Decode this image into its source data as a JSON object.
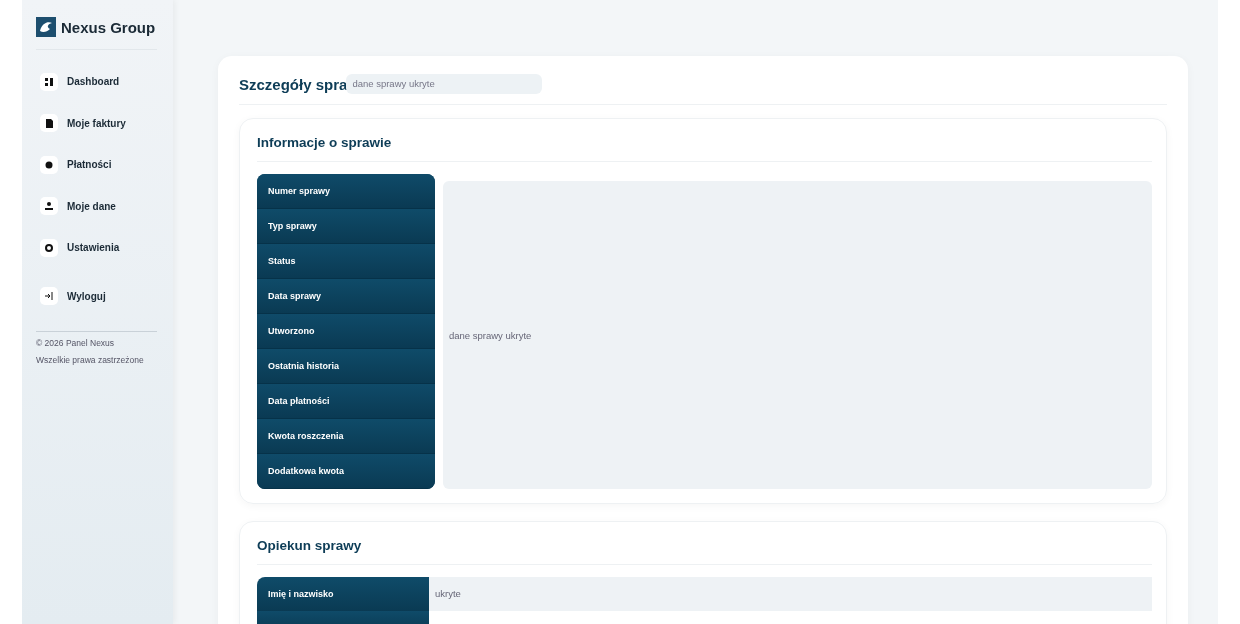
{
  "brand": {
    "name": "Nexus Group"
  },
  "sidebar": {
    "items": [
      {
        "kind": "grid",
        "label": "Dashboard"
      },
      {
        "kind": "doc",
        "label": "Moje faktury"
      },
      {
        "kind": "coin",
        "label": "Płatności"
      },
      {
        "kind": "user",
        "label": "Moje dane"
      },
      {
        "kind": "gear",
        "label": "Ustawienia"
      },
      {
        "kind": "logout",
        "label": "Wyloguj"
      }
    ],
    "footer": [
      "© 2026 Panel Nexus",
      "Wszelkie prawa zastrzeżone"
    ]
  },
  "page": {
    "title": "Szczegóły spra",
    "overlay_field": "dane sprawy ukryte"
  },
  "case_info": {
    "title": "Informacje o sprawie",
    "labels": [
      "Numer sprawy",
      "Typ sprawy",
      "Status",
      "Data sprawy",
      "Utworzono",
      "Ostatnia historia",
      "Data płatności",
      "Kwota roszczenia",
      "Dodatkowa kwota"
    ],
    "value": "dane sprawy ukryte"
  },
  "case_owner": {
    "title": "Opiekun sprawy",
    "rows": [
      {
        "label": "Imię i nazwisko",
        "value": "ukryte"
      }
    ]
  }
}
